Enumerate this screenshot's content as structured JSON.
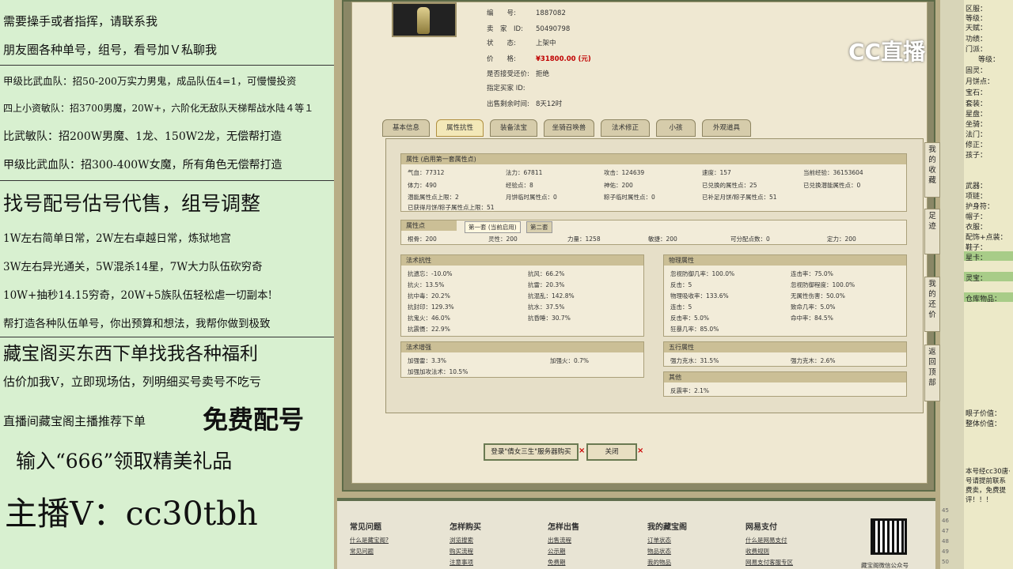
{
  "left_panel": {
    "lines": [
      "需要操手或者指挥，请联系我",
      "朋友圈各种单号，组号，看号加Ｖ私聊我",
      "甲级比武血队：招50-200万实力男鬼，成品队伍4=1，可慢慢投资",
      "四上小资敏队：招3700男魔，20W+，六阶化无敌队天梯帮战水陆４等１",
      "比武敏队：招200W男魔、1龙、150W2龙，无偿帮打造",
      "甲级比武血队：招300-400W女魔，所有角色无偿帮打造",
      "找号配号估号代售，组号调整",
      "1W左右简单日常，2W左右卓越日常，炼狱地宫",
      "3W左右异光通关，5W混杀14星，7W大力队伍砍穷奇",
      "10W+抽秒14.15穷奇，20W+5族队伍轻松虐一切副本!",
      "帮打造各种队伍单号，你出预算和想法，我帮你做到极致",
      "藏宝阁买东西下单找我各种福利",
      "估价加我V，立即现场估，列明细买号卖号不吃亏",
      "直播间藏宝阁主播推荐下单",
      "免费配号",
      "输入“666”领取精美礼品",
      "主播V：cc30tbh"
    ]
  },
  "item": {
    "rows": [
      {
        "label": "编　　号:",
        "value": "1887082"
      },
      {
        "label": "卖　家　ID:",
        "value": "50490798"
      },
      {
        "label": "状　　态:",
        "value": "上架中"
      },
      {
        "label": "价　　格:",
        "value": "¥31800.00 (元)"
      },
      {
        "label": "是否接受还价:",
        "value": "拒绝"
      },
      {
        "label": "指定买家 ID:",
        "value": ""
      },
      {
        "label": "出售剩余时间:",
        "value": "8天12时"
      }
    ]
  },
  "tabs": [
    "基本信息",
    "属性抗性",
    "装备法宝",
    "坐骑召唤兽",
    "法术修正",
    "小孩",
    "外观道具"
  ],
  "attr_box": {
    "title": "属性 (启用第一套属性点)",
    "cells": [
      "气血：77312",
      "法力：67811",
      "攻击：124639",
      "速度：157",
      "当前经验：36153604",
      "体力：490",
      "经验点：8",
      "神佑：200",
      "已兑换的属性点：25",
      "已兑换潜能属性点：0",
      "潜能属性点上限：2",
      "月饼临时属性点：0",
      "粽子临时属性点：0",
      "已补足月饼/粽子属性点：51",
      "已获得月饼/粽子属性点上限：51"
    ]
  },
  "points_box": {
    "title": "属性点",
    "subtabs": [
      "第一套 (当前启用)",
      "第二套"
    ],
    "cells": [
      "根骨：200",
      "灵性：200",
      "力量：1258",
      "敏捷：200",
      "可分配点数：0",
      "定力：200"
    ]
  },
  "resist_box": {
    "title": "法术抗性",
    "cells": [
      "抗遗忘：-10.0%",
      "抗风：66.2%",
      "抗火：13.5%",
      "抗雷：20.3%",
      "抗中毒：20.2%",
      "抗混乱：142.8%",
      "抗封印：129.3%",
      "抗水：37.5%",
      "抗鬼火：46.0%",
      "抗昏睡：30.7%",
      "抗震慑：22.9%"
    ]
  },
  "boost_box": {
    "title": "法术增强",
    "cells": [
      "加强雷：3.3%",
      "加强火：0.7%",
      "加强加攻法术：10.5%"
    ]
  },
  "phys_box": {
    "title": "物理属性",
    "cells": [
      "忽视防御几率：100.0%",
      "连击率：75.0%",
      "反击：5",
      "忽视防御程度：100.0%",
      "物理吸收率：133.6%",
      "无属性伤害：50.0%",
      "连击：5",
      "致命几率：5.0%",
      "反击率：5.0%",
      "命中率：84.5%",
      "狂暴几率：85.0%"
    ]
  },
  "five_box": {
    "title": "五行属性",
    "cells": [
      "强力克水：31.5%",
      "强力克木：2.6%"
    ]
  },
  "other_box": {
    "title": "其他",
    "cells": [
      "反震率：2.1%"
    ]
  },
  "buttons": {
    "login_buy": "登录\"倩女三生\"服务器购买",
    "close": "关闭",
    "x_mark": "×"
  },
  "footer": {
    "columns": [
      {
        "title": "常见问题",
        "links": [
          "什么是藏宝阁?",
          "常见问题"
        ]
      },
      {
        "title": "怎样购买",
        "links": [
          "浏览搜索",
          "购买流程",
          "注意事项"
        ]
      },
      {
        "title": "怎样出售",
        "links": [
          "出售流程",
          "公示期",
          "免费期"
        ]
      },
      {
        "title": "我的藏宝阁",
        "links": [
          "订单状态",
          "物品状态",
          "我的物品"
        ]
      },
      {
        "title": "网易支付",
        "links": [
          "什么是网易支付",
          "收费规则",
          "网易支付客服专区"
        ]
      }
    ],
    "qr_caption": "藏宝阁微信公众号"
  },
  "side_tabs": [
    "我的收藏",
    "足迹",
    "我的还价",
    "返回顶部"
  ],
  "right_panel": {
    "lines": [
      "区服：",
      "等级：",
      "天赋：",
      "功绩：",
      "门派：",
      "等级：",
      "固灵：",
      "月饼点：",
      "宝石：",
      "套装：",
      "星盘：",
      "坐骑：",
      "法门：",
      "修正：",
      "孩子：",
      "武器：",
      "项链：",
      "护身符：",
      "帽子：",
      "衣服：",
      "配饰+点装：",
      "鞋子：",
      "星卡：",
      "灵宝：",
      "仓库物品：",
      "眼子价值：",
      "整体价值：",
      "本号经cc30唐·",
      "号请提前联系",
      "费卖，免费提",
      "评！！！"
    ],
    "line_numbers": [
      "45",
      "46",
      "47",
      "48",
      "49",
      "50"
    ]
  },
  "logo": {
    "text": "CC直播"
  },
  "colors": {
    "left_bg": "#d8f0d0",
    "price_red": "#c00000",
    "frame_green": "#5d6b48",
    "highlight_green": "#a8cc88"
  }
}
